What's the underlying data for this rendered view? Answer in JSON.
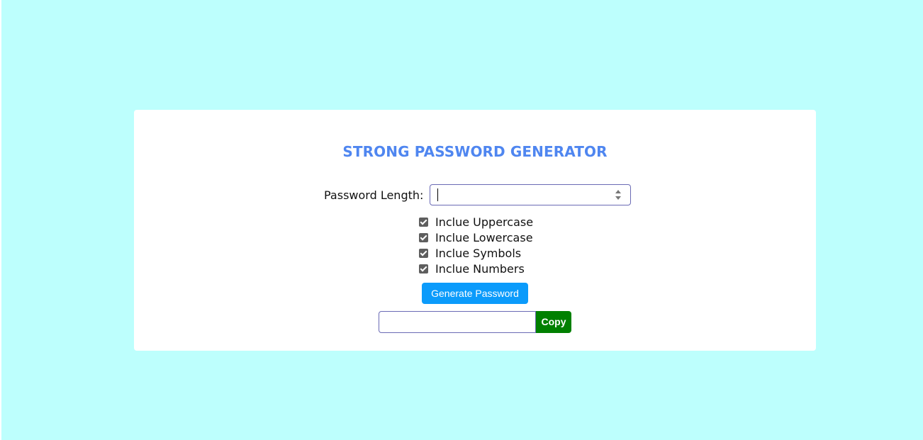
{
  "title": "STRONG PASSWORD GENERATOR",
  "length": {
    "label": "Password Length:",
    "value": ""
  },
  "options": [
    {
      "label": "Inclue Uppercase",
      "checked": true
    },
    {
      "label": "Inclue Lowercase",
      "checked": true
    },
    {
      "label": "Inclue Symbols",
      "checked": true
    },
    {
      "label": "Inclue Numbers",
      "checked": true
    }
  ],
  "generate_label": "Generate Password",
  "output": {
    "value": ""
  },
  "copy_label": "Copy",
  "colors": {
    "background": "#bdfffd",
    "title": "#4f86f0",
    "generate_button": "#0b9bfb",
    "copy_button": "#008000",
    "input_border": "#6a6ab5"
  }
}
